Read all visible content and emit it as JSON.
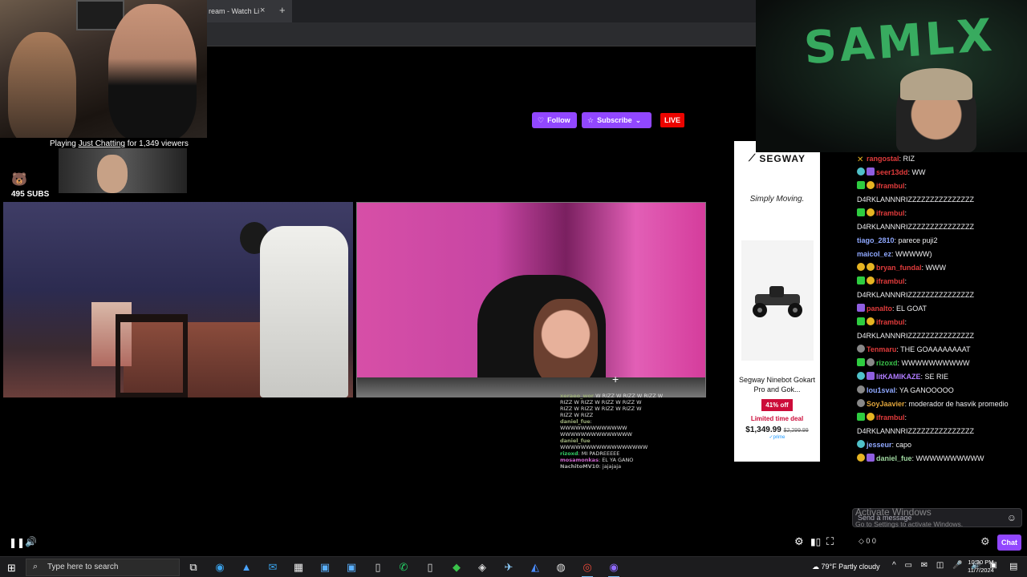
{
  "browser": {
    "tab_title": "ream - Watch Li",
    "tab_close": "×",
    "tab_new": "+"
  },
  "channel": {
    "follow_label": "Follow",
    "subscribe_label": "Subscribe",
    "live_label": "LIVE",
    "playing_prefix": "Playing ",
    "playing_category": "Just Chatting",
    "playing_suffix": " for 1,349 viewers",
    "subs_text": "495 SUBS"
  },
  "overlay_chat": [
    {
      "name": "xeraeo_wor",
      "text": " W RIZZ W RIZZ W RIZZ W",
      "color": "#9a7"
    },
    {
      "name": "",
      "text": "RIZZ W RIZZ W RIZZ W RIZZ W",
      "color": "#ddd"
    },
    {
      "name": "",
      "text": "RIZZ W RIZZ W RIZZ W RIZZ W",
      "color": "#ddd"
    },
    {
      "name": "",
      "text": "RIZZ W RIZZ",
      "color": "#ddd"
    },
    {
      "name": "daniel_fue",
      "text": ":",
      "color": "#9a7"
    },
    {
      "name": "",
      "text": "WWWWWWWWWWWWW",
      "color": "#ddd"
    },
    {
      "name": "",
      "text": "WWWWWWWWWWWWWW",
      "color": "#ddd"
    },
    {
      "name": "daniel_fue",
      "text": "",
      "color": "#9a7"
    },
    {
      "name": "",
      "text": "WWWWWWWWWWWWWWWWW",
      "color": "#ddd"
    },
    {
      "name": "rizoxd",
      "text": ": MI PADREEEEE",
      "color": "#3c6"
    },
    {
      "name": "mosamonkas",
      "text": ": EL YA GANO",
      "color": "#c6c"
    },
    {
      "name": "NachitoMV10",
      "text": ": jajajaja",
      "color": "#aaa"
    }
  ],
  "ad": {
    "brand": "SEGWAY",
    "tagline": "Simply Moving.",
    "product_title": "Segway Ninebot Gokart Pro and Gok...",
    "discount": "41% off",
    "deal": "Limited time deal",
    "price": "$1,349.99",
    "old_price": "$2,299.99",
    "prime": "✓prime"
  },
  "cam_right": {
    "graffiti": "SAMLX"
  },
  "chat": {
    "messages": [
      {
        "badges": [
          "x"
        ],
        "user": "rangostal",
        "user_color": "#e03b3b",
        "text": ": RIZ"
      },
      {
        "badges": [
          "teal",
          "purple"
        ],
        "user": "seer13dd",
        "user_color": "#e03b3b",
        "text": ": WW"
      },
      {
        "badges": [
          "green",
          "gold"
        ],
        "user": "iframbul",
        "user_color": "#e03b3b",
        "text": ":"
      },
      {
        "badges": [],
        "user": "",
        "user_color": "#fff",
        "text": "D4RKLANNNRIZZZZZZZZZZZZZZZ"
      },
      {
        "badges": [
          "green",
          "gold"
        ],
        "user": "iframbul",
        "user_color": "#e03b3b",
        "text": ":"
      },
      {
        "badges": [],
        "user": "",
        "user_color": "#fff",
        "text": "D4RKLANNNRIZZZZZZZZZZZZZZZ"
      },
      {
        "badges": [],
        "user": "tiago_2810",
        "user_color": "#8fa8ff",
        "text": ": parece puji2"
      },
      {
        "badges": [],
        "user": "maicol_ez",
        "user_color": "#8fa8ff",
        "text": ": WWWWW)"
      },
      {
        "badges": [
          "gold",
          "gold"
        ],
        "user": "bryan_fundal",
        "user_color": "#e03b3b",
        "text": ": WWW"
      },
      {
        "badges": [
          "green",
          "gold"
        ],
        "user": "iframbul",
        "user_color": "#e03b3b",
        "text": ":"
      },
      {
        "badges": [],
        "user": "",
        "user_color": "#fff",
        "text": "D4RKLANNNRIZZZZZZZZZZZZZZZ"
      },
      {
        "badges": [
          "purple"
        ],
        "user": "panalto",
        "user_color": "#e03b3b",
        "text": ": EL GOAT"
      },
      {
        "badges": [
          "green",
          "gold"
        ],
        "user": "iframbul",
        "user_color": "#e03b3b",
        "text": ":"
      },
      {
        "badges": [],
        "user": "",
        "user_color": "#fff",
        "text": "D4RKLANNNRIZZZZZZZZZZZZZZZ"
      },
      {
        "badges": [
          "gray"
        ],
        "user": "Tenmaru",
        "user_color": "#e03b3b",
        "text": ": THE GOAAAAAAAAT"
      },
      {
        "badges": [
          "green",
          "gray"
        ],
        "user": "rizoxd",
        "user_color": "#3ac24a",
        "text": ": WWWWWWWWWW"
      },
      {
        "badges": [
          "teal",
          "purple"
        ],
        "user": "litKAMIKAZE",
        "user_color": "#b07cff",
        "text": ": SE RIE"
      },
      {
        "badges": [
          "gray"
        ],
        "user": "lou1sval",
        "user_color": "#8fa8ff",
        "text": ": YA GANOOOOO"
      },
      {
        "badges": [
          "gray"
        ],
        "user": "SoyJaavier",
        "user_color": "#e0a43b",
        "text": ": moderador de hasvik promedio"
      },
      {
        "badges": [
          "green",
          "gold"
        ],
        "user": "iframbul",
        "user_color": "#e03b3b",
        "text": ":"
      },
      {
        "badges": [],
        "user": "",
        "user_color": "#fff",
        "text": "D4RKLANNNRIZZZZZZZZZZZZZZZ"
      },
      {
        "badges": [
          "teal"
        ],
        "user": "jesseur",
        "user_color": "#8fa8ff",
        "text": ": capo"
      },
      {
        "badges": [
          "gold",
          "purple"
        ],
        "user": "daniel_fue",
        "user_color": "#9fd8a0",
        "text": ": WWWWWWWWWW"
      }
    ],
    "input_placeholder": "Send a message",
    "points": "0  0",
    "chat_button": "Chat"
  },
  "windows_watermark": {
    "title": "Activate Windows",
    "subtitle": "Go to Settings to activate Windows."
  },
  "taskbar": {
    "search_placeholder": "Type here to search",
    "weather": "79°F  Partly cloudy",
    "time": "10:30 PM",
    "date": "11/7/2024"
  }
}
